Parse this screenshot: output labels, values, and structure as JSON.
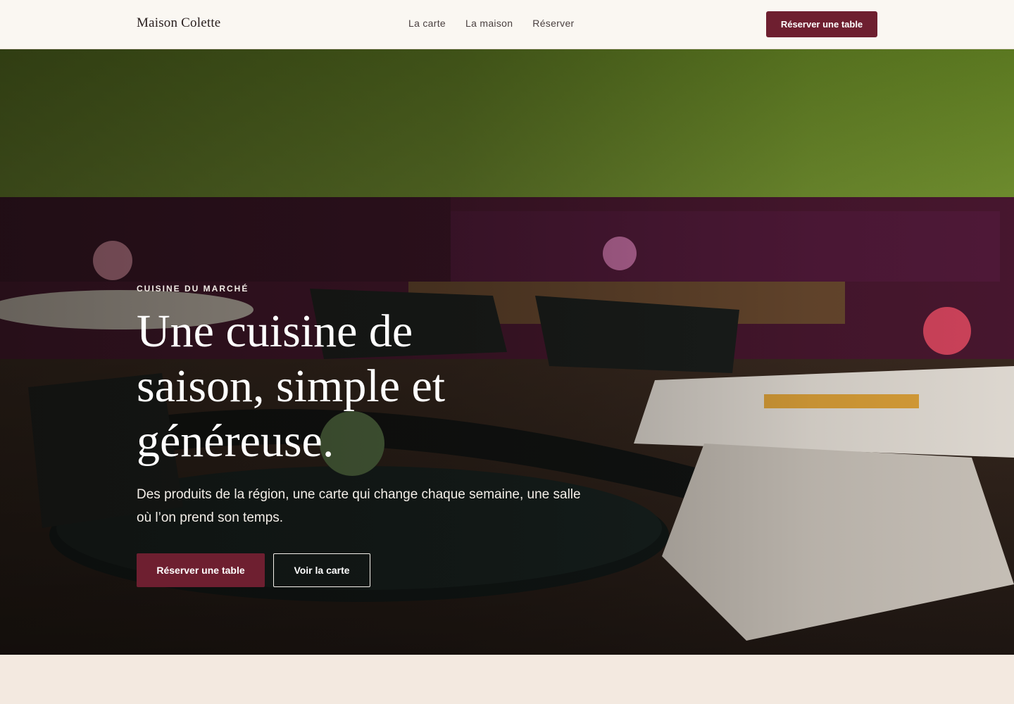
{
  "header": {
    "brand": "Maison Colette",
    "nav": [
      {
        "label": "La carte"
      },
      {
        "label": "La maison"
      },
      {
        "label": "Réserver"
      }
    ],
    "cta_label": "Réserver une table"
  },
  "hero": {
    "eyebrow": "CUISINE DU MARCHÉ",
    "headline": "Une cuisine de saison, simple et généreuse.",
    "lede": "Des produits de la région, une carte qui change chaque semaine, une salle où l’on prend son temps.",
    "primary_label": "Réserver une table",
    "secondary_label": "Voir la carte"
  },
  "colors": {
    "accent": "#6e1f30",
    "header_bg": "#faf7f2",
    "page_bg": "#f3e9e0",
    "wall_green": "#6c8a2c",
    "banquette": "#4a1730"
  },
  "icons": {
    "hero_image": "restaurant-interior-photo"
  }
}
